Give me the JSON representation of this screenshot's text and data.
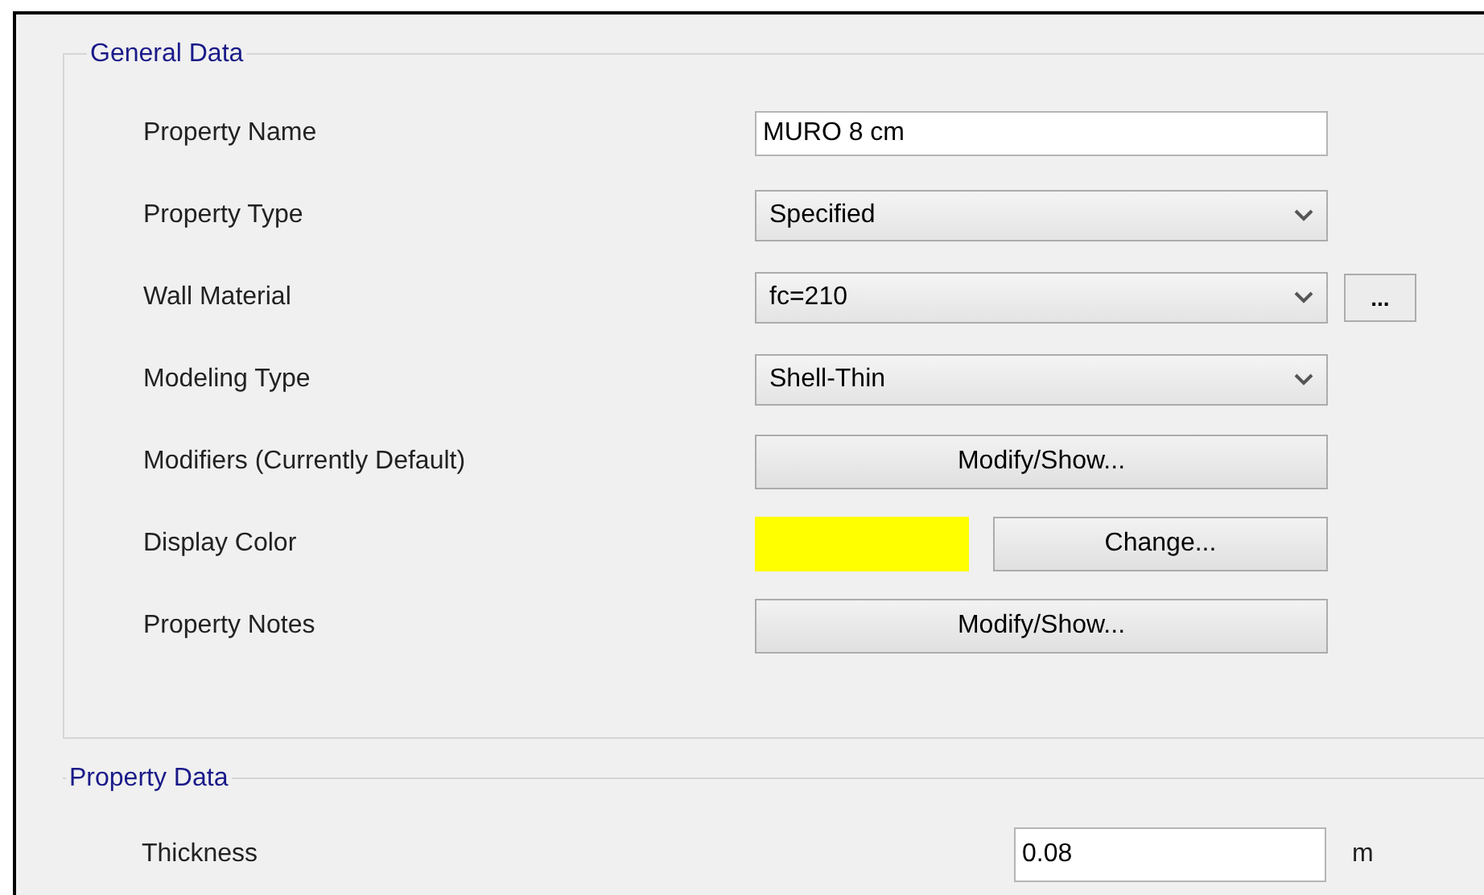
{
  "general_data": {
    "title": "General Data",
    "rows": [
      {
        "label": "Property Name",
        "kind": "text",
        "value": "MURO 8 cm"
      },
      {
        "label": "Property Type",
        "kind": "select",
        "value": "Specified"
      },
      {
        "label": "Wall Material",
        "kind": "select_more",
        "value": "fc=210",
        "more": "..."
      },
      {
        "label": "Modeling Type",
        "kind": "select",
        "value": "Shell-Thin"
      },
      {
        "label": "Modifiers (Currently Default)",
        "kind": "button",
        "value": "Modify/Show..."
      },
      {
        "label": "Display Color",
        "kind": "color",
        "color": "#ffff00",
        "value": "Change..."
      },
      {
        "label": "Property Notes",
        "kind": "button",
        "value": "Modify/Show..."
      }
    ]
  },
  "property_data": {
    "title": "Property Data",
    "rows": [
      {
        "label": "Thickness",
        "value": "0.08",
        "unit": "m"
      }
    ]
  }
}
